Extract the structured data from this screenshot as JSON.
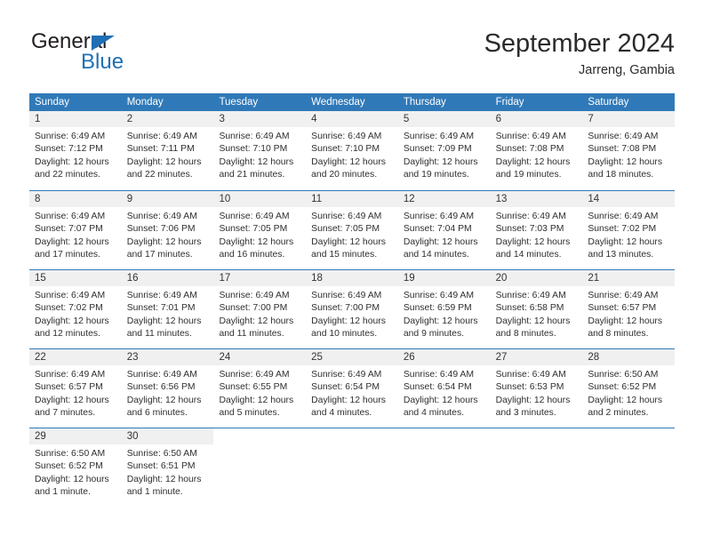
{
  "brand": {
    "word_one": "General",
    "word_two": "Blue",
    "flag_icon": "triangle-flag-icon",
    "accent_color": "#1f6fb4"
  },
  "header": {
    "title": "September 2024",
    "subtitle": "Jarreng, Gambia"
  },
  "calendar": {
    "header_bg": "#3079b8",
    "daynum_bg": "#f0f0f0",
    "weekdays": [
      "Sunday",
      "Monday",
      "Tuesday",
      "Wednesday",
      "Thursday",
      "Friday",
      "Saturday"
    ],
    "weeks": [
      [
        {
          "day": "1",
          "sunrise": "Sunrise: 6:49 AM",
          "sunset": "Sunset: 7:12 PM",
          "daylight1": "Daylight: 12 hours",
          "daylight2": "and 22 minutes."
        },
        {
          "day": "2",
          "sunrise": "Sunrise: 6:49 AM",
          "sunset": "Sunset: 7:11 PM",
          "daylight1": "Daylight: 12 hours",
          "daylight2": "and 22 minutes."
        },
        {
          "day": "3",
          "sunrise": "Sunrise: 6:49 AM",
          "sunset": "Sunset: 7:10 PM",
          "daylight1": "Daylight: 12 hours",
          "daylight2": "and 21 minutes."
        },
        {
          "day": "4",
          "sunrise": "Sunrise: 6:49 AM",
          "sunset": "Sunset: 7:10 PM",
          "daylight1": "Daylight: 12 hours",
          "daylight2": "and 20 minutes."
        },
        {
          "day": "5",
          "sunrise": "Sunrise: 6:49 AM",
          "sunset": "Sunset: 7:09 PM",
          "daylight1": "Daylight: 12 hours",
          "daylight2": "and 19 minutes."
        },
        {
          "day": "6",
          "sunrise": "Sunrise: 6:49 AM",
          "sunset": "Sunset: 7:08 PM",
          "daylight1": "Daylight: 12 hours",
          "daylight2": "and 19 minutes."
        },
        {
          "day": "7",
          "sunrise": "Sunrise: 6:49 AM",
          "sunset": "Sunset: 7:08 PM",
          "daylight1": "Daylight: 12 hours",
          "daylight2": "and 18 minutes."
        }
      ],
      [
        {
          "day": "8",
          "sunrise": "Sunrise: 6:49 AM",
          "sunset": "Sunset: 7:07 PM",
          "daylight1": "Daylight: 12 hours",
          "daylight2": "and 17 minutes."
        },
        {
          "day": "9",
          "sunrise": "Sunrise: 6:49 AM",
          "sunset": "Sunset: 7:06 PM",
          "daylight1": "Daylight: 12 hours",
          "daylight2": "and 17 minutes."
        },
        {
          "day": "10",
          "sunrise": "Sunrise: 6:49 AM",
          "sunset": "Sunset: 7:05 PM",
          "daylight1": "Daylight: 12 hours",
          "daylight2": "and 16 minutes."
        },
        {
          "day": "11",
          "sunrise": "Sunrise: 6:49 AM",
          "sunset": "Sunset: 7:05 PM",
          "daylight1": "Daylight: 12 hours",
          "daylight2": "and 15 minutes."
        },
        {
          "day": "12",
          "sunrise": "Sunrise: 6:49 AM",
          "sunset": "Sunset: 7:04 PM",
          "daylight1": "Daylight: 12 hours",
          "daylight2": "and 14 minutes."
        },
        {
          "day": "13",
          "sunrise": "Sunrise: 6:49 AM",
          "sunset": "Sunset: 7:03 PM",
          "daylight1": "Daylight: 12 hours",
          "daylight2": "and 14 minutes."
        },
        {
          "day": "14",
          "sunrise": "Sunrise: 6:49 AM",
          "sunset": "Sunset: 7:02 PM",
          "daylight1": "Daylight: 12 hours",
          "daylight2": "and 13 minutes."
        }
      ],
      [
        {
          "day": "15",
          "sunrise": "Sunrise: 6:49 AM",
          "sunset": "Sunset: 7:02 PM",
          "daylight1": "Daylight: 12 hours",
          "daylight2": "and 12 minutes."
        },
        {
          "day": "16",
          "sunrise": "Sunrise: 6:49 AM",
          "sunset": "Sunset: 7:01 PM",
          "daylight1": "Daylight: 12 hours",
          "daylight2": "and 11 minutes."
        },
        {
          "day": "17",
          "sunrise": "Sunrise: 6:49 AM",
          "sunset": "Sunset: 7:00 PM",
          "daylight1": "Daylight: 12 hours",
          "daylight2": "and 11 minutes."
        },
        {
          "day": "18",
          "sunrise": "Sunrise: 6:49 AM",
          "sunset": "Sunset: 7:00 PM",
          "daylight1": "Daylight: 12 hours",
          "daylight2": "and 10 minutes."
        },
        {
          "day": "19",
          "sunrise": "Sunrise: 6:49 AM",
          "sunset": "Sunset: 6:59 PM",
          "daylight1": "Daylight: 12 hours",
          "daylight2": "and 9 minutes."
        },
        {
          "day": "20",
          "sunrise": "Sunrise: 6:49 AM",
          "sunset": "Sunset: 6:58 PM",
          "daylight1": "Daylight: 12 hours",
          "daylight2": "and 8 minutes."
        },
        {
          "day": "21",
          "sunrise": "Sunrise: 6:49 AM",
          "sunset": "Sunset: 6:57 PM",
          "daylight1": "Daylight: 12 hours",
          "daylight2": "and 8 minutes."
        }
      ],
      [
        {
          "day": "22",
          "sunrise": "Sunrise: 6:49 AM",
          "sunset": "Sunset: 6:57 PM",
          "daylight1": "Daylight: 12 hours",
          "daylight2": "and 7 minutes."
        },
        {
          "day": "23",
          "sunrise": "Sunrise: 6:49 AM",
          "sunset": "Sunset: 6:56 PM",
          "daylight1": "Daylight: 12 hours",
          "daylight2": "and 6 minutes."
        },
        {
          "day": "24",
          "sunrise": "Sunrise: 6:49 AM",
          "sunset": "Sunset: 6:55 PM",
          "daylight1": "Daylight: 12 hours",
          "daylight2": "and 5 minutes."
        },
        {
          "day": "25",
          "sunrise": "Sunrise: 6:49 AM",
          "sunset": "Sunset: 6:54 PM",
          "daylight1": "Daylight: 12 hours",
          "daylight2": "and 4 minutes."
        },
        {
          "day": "26",
          "sunrise": "Sunrise: 6:49 AM",
          "sunset": "Sunset: 6:54 PM",
          "daylight1": "Daylight: 12 hours",
          "daylight2": "and 4 minutes."
        },
        {
          "day": "27",
          "sunrise": "Sunrise: 6:49 AM",
          "sunset": "Sunset: 6:53 PM",
          "daylight1": "Daylight: 12 hours",
          "daylight2": "and 3 minutes."
        },
        {
          "day": "28",
          "sunrise": "Sunrise: 6:50 AM",
          "sunset": "Sunset: 6:52 PM",
          "daylight1": "Daylight: 12 hours",
          "daylight2": "and 2 minutes."
        }
      ],
      [
        {
          "day": "29",
          "sunrise": "Sunrise: 6:50 AM",
          "sunset": "Sunset: 6:52 PM",
          "daylight1": "Daylight: 12 hours",
          "daylight2": "and 1 minute."
        },
        {
          "day": "30",
          "sunrise": "Sunrise: 6:50 AM",
          "sunset": "Sunset: 6:51 PM",
          "daylight1": "Daylight: 12 hours",
          "daylight2": "and 1 minute."
        },
        {
          "day": "",
          "sunrise": "",
          "sunset": "",
          "daylight1": "",
          "daylight2": ""
        },
        {
          "day": "",
          "sunrise": "",
          "sunset": "",
          "daylight1": "",
          "daylight2": ""
        },
        {
          "day": "",
          "sunrise": "",
          "sunset": "",
          "daylight1": "",
          "daylight2": ""
        },
        {
          "day": "",
          "sunrise": "",
          "sunset": "",
          "daylight1": "",
          "daylight2": ""
        },
        {
          "day": "",
          "sunrise": "",
          "sunset": "",
          "daylight1": "",
          "daylight2": ""
        }
      ]
    ]
  }
}
